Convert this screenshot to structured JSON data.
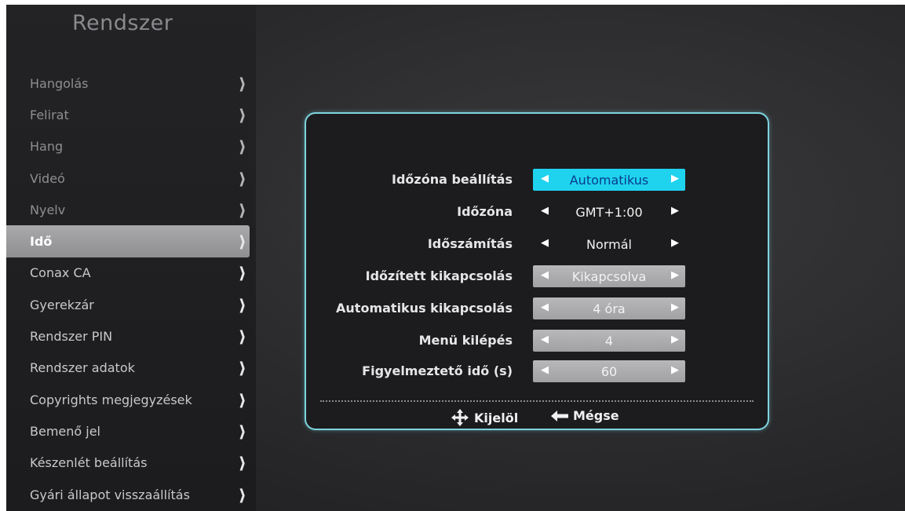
{
  "sidebar": {
    "title": "Rendszer",
    "items": [
      {
        "label": "Hangolás"
      },
      {
        "label": "Felirat"
      },
      {
        "label": "Hang"
      },
      {
        "label": "Videó"
      },
      {
        "label": "Nyelv"
      },
      {
        "label": "Idő"
      },
      {
        "label": "Conax CA"
      },
      {
        "label": "Gyerekzár"
      },
      {
        "label": "Rendszer PIN"
      },
      {
        "label": "Rendszer adatok"
      },
      {
        "label": "Copyrights megjegyzések"
      },
      {
        "label": "Bemenő jel"
      },
      {
        "label": "Készenlét beállítás"
      },
      {
        "label": "Gyári állapot visszaállítás"
      }
    ],
    "selected_index": 5
  },
  "settings": {
    "rows": [
      {
        "label": "Időzóna beállítás",
        "value": "Automatikus"
      },
      {
        "label": "Időzóna",
        "value": "GMT+1:00"
      },
      {
        "label": "Időszámítás",
        "value": "Normál"
      },
      {
        "label": "Időzített kikapcsolás",
        "value": "Kikapcsolva"
      },
      {
        "label": "Automatikus kikapcsolás",
        "value": "4 óra"
      },
      {
        "label": "Menü kilépés",
        "value": "4"
      },
      {
        "label": "Figyelmeztető idő (s)",
        "value": "60"
      }
    ]
  },
  "footer": {
    "select_hint": "Kijelöl",
    "back_hint": "Mégse"
  },
  "icons": {
    "menu_chevron": "chevron-right-icon",
    "value_left": "triangle-left-icon",
    "value_right": "triangle-right-icon",
    "select": "four-way-arrows-icon",
    "back": "arrow-left-icon"
  },
  "colors": {
    "accent": "#1fd3ee",
    "active_text": "#0a3b8e",
    "panel_border": "#7fd3e0",
    "selected_menu": "#a0a0a3"
  }
}
